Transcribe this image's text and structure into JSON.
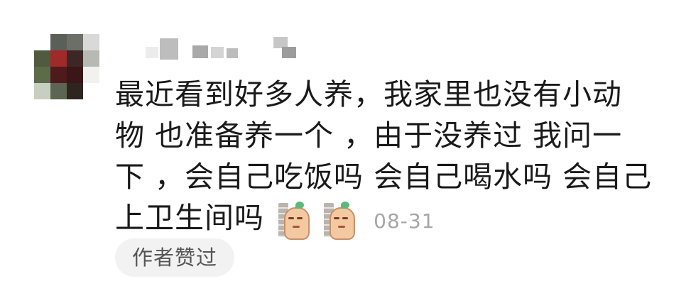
{
  "comment": {
    "avatar_icon": "avatar-blurred",
    "username_blurred": true,
    "text_lines": [
      "最近看到好多人养，我家里也没有小动",
      "物 也准备养一个 ，由于没养过 我问一",
      "下 ，会自己吃饭吗 会自己喝水吗 会自己",
      "上卫生间吗"
    ],
    "stickers": [
      "smirk-sticker",
      "smirk-sticker"
    ],
    "timestamp": "08-31",
    "author_liked_label": "作者赞过"
  },
  "colors": {
    "text": "#1a1a1a",
    "timestamp": "#a6a6a6",
    "badge_bg": "#f2f2f2",
    "badge_text": "#555555"
  }
}
